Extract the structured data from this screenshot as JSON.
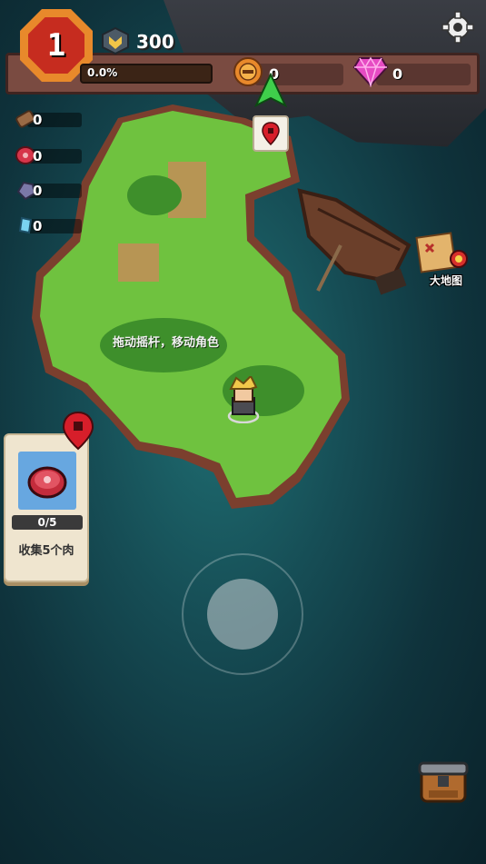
{
  "player": {
    "level": "1",
    "xp": "300",
    "progress_text": "0.0%",
    "progress_fraction": 0.0
  },
  "resources": {
    "coins": "0",
    "gems": "0"
  },
  "materials": [
    {
      "name": "wood-icon",
      "value": "0"
    },
    {
      "name": "meat-icon",
      "value": "0"
    },
    {
      "name": "stone-icon",
      "value": "0"
    },
    {
      "name": "crystal-icon",
      "value": "0"
    }
  ],
  "map": {
    "label": "大地图"
  },
  "hint": "拖动摇杆，移动角色",
  "quest": {
    "progress": "0/5",
    "description": "收集5个肉"
  },
  "colors": {
    "grass": "#6fc23f",
    "water": "#1f6f73",
    "hud": "#7a4b41",
    "badge": "#c62c1f"
  }
}
